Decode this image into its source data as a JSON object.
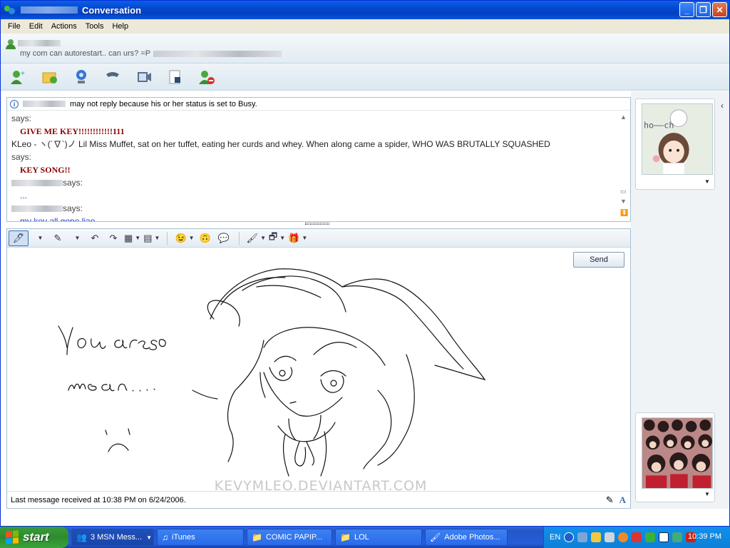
{
  "window": {
    "title": "Conversation"
  },
  "menu": [
    "File",
    "Edit",
    "Actions",
    "Tools",
    "Help"
  ],
  "contact": {
    "personal_message": "my com can autorestart.. can urs? =P"
  },
  "toolbar_icons": [
    "invite-contact-icon",
    "send-files-icon",
    "webcam-icon",
    "call-icon",
    "video-call-icon",
    "activities-icon",
    "block-icon"
  ],
  "info_bar": {
    "text": "may not reply because his or her status is set to Busy."
  },
  "history": [
    {
      "type": "says",
      "text": "says:"
    },
    {
      "type": "red",
      "text": "GIVE ME KEY!!!!!!!!!!!!111"
    },
    {
      "type": "plain",
      "text": "KLeo - ヽ(´∇`)ノ Lil Miss Muffet, sat on her tuffet, eating her curds and whey. When along came a spider, WHO WAS BRUTALLY SQUASHED"
    },
    {
      "type": "says",
      "text": "says:"
    },
    {
      "type": "red",
      "text": "KEY SONG!!"
    },
    {
      "type": "says_named",
      "text": "says:"
    },
    {
      "type": "blue",
      "text": "..."
    },
    {
      "type": "says_named",
      "text": "says:"
    },
    {
      "type": "blue",
      "text": "my key all gone liao..."
    }
  ],
  "ink": {
    "send_label": "Send",
    "handwriting_line1": "You are so",
    "handwriting_line2": "mean. . . .",
    "watermark": "KEVYMLEO.DEVIANTART.COM"
  },
  "status": {
    "last_message": "Last message received at 10:38 PM on 6/24/2006."
  },
  "display_pictures": {
    "top_text": "ho——ch"
  },
  "taskbar": {
    "start_label": "start",
    "tasks": [
      {
        "label": "3 MSN Mess...",
        "icon": "msn-icon",
        "active": true
      },
      {
        "label": "iTunes",
        "icon": "itunes-icon",
        "active": false
      },
      {
        "label": "COMIC PAPIP...",
        "icon": "folder-icon",
        "active": false
      },
      {
        "label": "LOL",
        "icon": "folder-icon",
        "active": false
      },
      {
        "label": "Adobe Photos...",
        "icon": "photoshop-icon",
        "active": false
      }
    ],
    "lang": "EN",
    "clock": "10:39 PM"
  },
  "colors": {
    "title_bar": "#0548d0",
    "history_red": "#8b0000",
    "history_blue": "#1a3fb5",
    "taskbar": "#245edb",
    "start_green": "#3c9b3c"
  }
}
